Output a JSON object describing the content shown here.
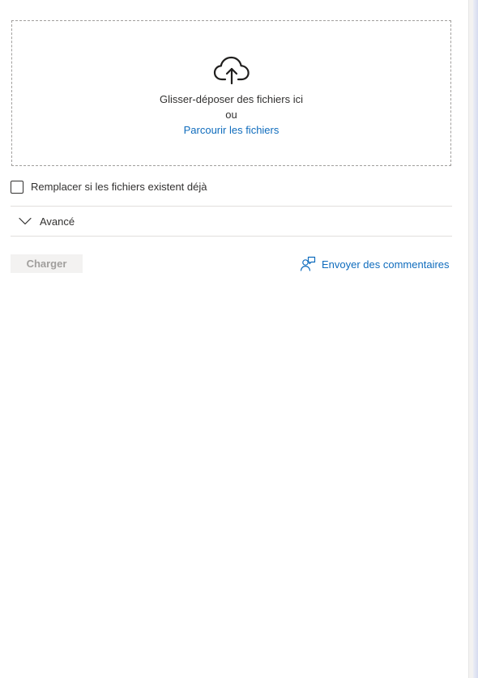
{
  "upload": {
    "drop_title": "Glisser-déposer des fichiers ici",
    "or_label": "ou",
    "browse_label": "Parcourir les fichiers",
    "upload_icon": "cloud-upload-icon"
  },
  "options": {
    "replace_label": "Remplacer si les fichiers existent déjà",
    "replace_checked": false,
    "advanced_label": "Avancé",
    "advanced_expanded": false,
    "chevron_icon": "chevron-down-icon"
  },
  "actions": {
    "charger_label": "Charger",
    "charger_disabled": true,
    "feedback_label": "Envoyer des commentaires",
    "feedback_icon": "person-feedback-icon"
  },
  "colors": {
    "link": "#0f6cbd",
    "text": "#323130",
    "disabled_button_bg": "#f3f2f1",
    "disabled_button_text": "#a19f9d",
    "divider": "#e1dfdd"
  }
}
